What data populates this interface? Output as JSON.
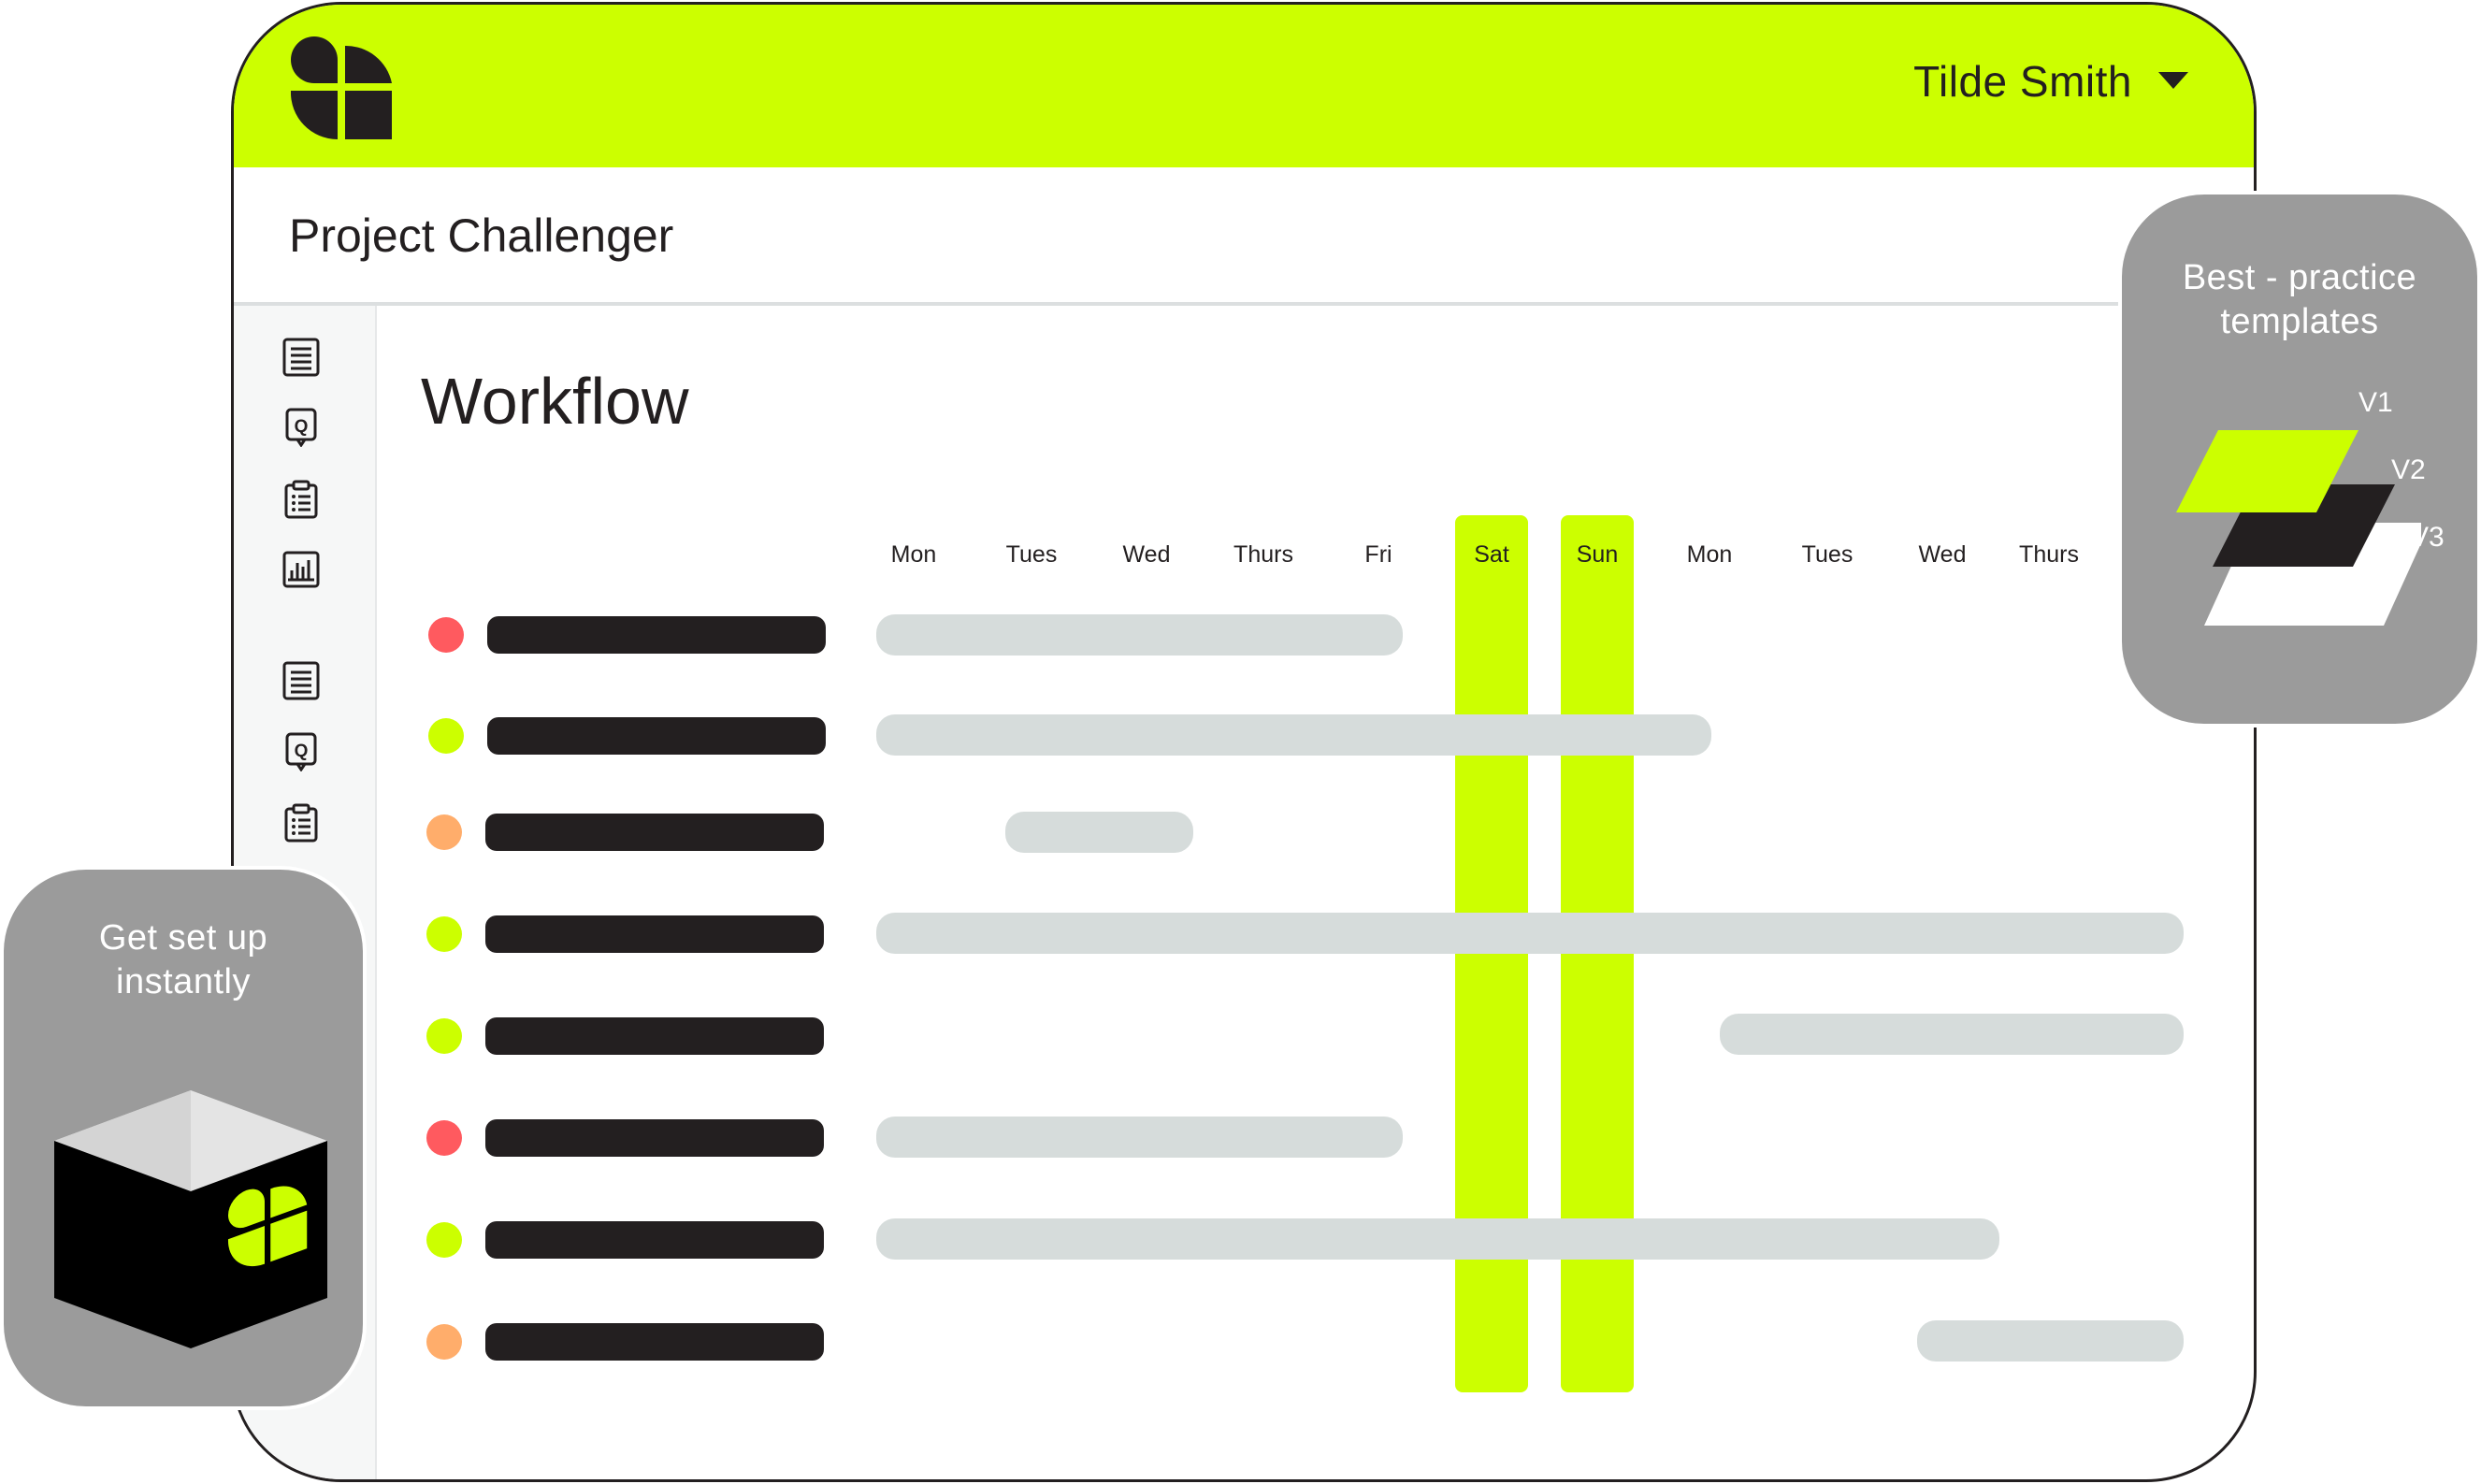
{
  "header": {
    "user_name": "Tilde Smith",
    "brand_logo": "cloverleaf-logo-icon",
    "caret_icon": "caret-down-icon"
  },
  "project": {
    "title": "Project Challenger"
  },
  "sidebar": {
    "icons": [
      "document-list-icon",
      "quote-icon",
      "clipboard-list-icon",
      "bar-chart-icon",
      "document-list-icon",
      "quote-icon",
      "clipboard-list-icon"
    ]
  },
  "workflow": {
    "heading": "Workflow",
    "days": [
      "Mon",
      "Tues",
      "Wed",
      "Thurs",
      "Fri",
      "Sat",
      "Sun",
      "Mon",
      "Tues",
      "Wed",
      "Thurs"
    ],
    "weekend_days": [
      "Sat",
      "Sun"
    ],
    "tasks": [
      {
        "status": "red",
        "span_days": "Mon–Fri"
      },
      {
        "status": "green",
        "span_days": "Mon–Mon"
      },
      {
        "status": "orange",
        "span_days": "Tues"
      },
      {
        "status": "green",
        "span_days": "Mon–Thurs"
      },
      {
        "status": "green",
        "span_days": "Mon–Thurs"
      },
      {
        "status": "red",
        "span_days": "Mon–Fri"
      },
      {
        "status": "green",
        "span_days": "Mon–Wed"
      },
      {
        "status": "orange",
        "span_days": "Wed–Thurs"
      }
    ]
  },
  "callouts": {
    "templates": {
      "title_line1": "Best - practice",
      "title_line2": "templates",
      "versions": [
        "V1",
        "V2",
        "V3"
      ]
    },
    "setup": {
      "title_line1": "Get set up",
      "title_line2": "instantly",
      "icon": "box-with-logo-icon"
    }
  },
  "colors": {
    "accent": "#ccff00",
    "dark": "#231f20",
    "bar": "#d6dcdb",
    "red": "#ff5a5f",
    "green": "#ccff00",
    "orange": "#ffad6b",
    "card": "#9b9b9b"
  }
}
